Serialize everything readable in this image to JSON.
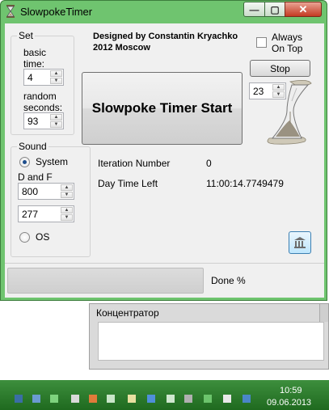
{
  "window": {
    "title": "SlowpokeTimer",
    "minimize_glyph": "—",
    "maximize_glyph": "▢",
    "close_glyph": "✕"
  },
  "credits": {
    "line1": "Designed by Constantin Kryachko",
    "line2": "2012 Moscow"
  },
  "always_on_top": {
    "line1": "Always",
    "line2": "On Top",
    "checked": false
  },
  "set_group": {
    "title": "Set",
    "basic_time_label_1": "basic",
    "basic_time_label_2": "time:",
    "basic_time_value": "4",
    "random_seconds_label_1": "random",
    "random_seconds_label_2": "seconds:",
    "random_seconds_value": "93"
  },
  "sound_group": {
    "title": "Sound",
    "system_label": "System",
    "system_selected": true,
    "d_and_f_label": "D and F",
    "frequency_value": "800",
    "duration_value": "277",
    "os_label": "OS",
    "os_selected": false
  },
  "start_button_label": "Slowpoke Timer Start",
  "stop_button_label": "Stop",
  "counter_value": "23",
  "status": {
    "iteration_label": "Iteration Number",
    "iteration_value": "0",
    "daytime_label": "Day Time Left",
    "daytime_value": "11:00:14.7749479"
  },
  "progress": {
    "value": 0,
    "label": "Done %"
  },
  "second_window": {
    "title": "Концентратор"
  },
  "taskbar": {
    "time": "10:59",
    "date": "09.06.2013"
  },
  "colors": {
    "window_frame": "#6fc46f",
    "taskbar": "#2a7a2a",
    "client_bg": "#f0f0f0"
  }
}
